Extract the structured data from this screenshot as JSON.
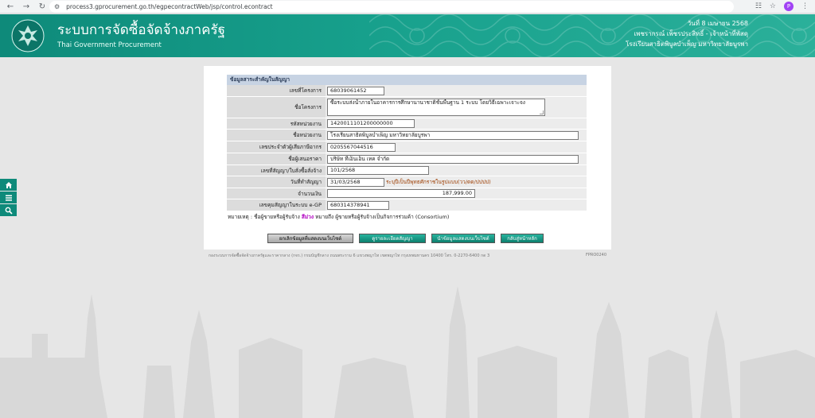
{
  "browser": {
    "url": "process3.gprocurement.go.th/egpecontractWeb/jsp/control.econtract",
    "profile_initial": "P"
  },
  "header": {
    "title_th": "ระบบการจัดซื้อจัดจ้างภาครัฐ",
    "title_en": "Thai Government Procurement",
    "date": "วันที่ 8 เมษายน 2568",
    "user": "เพชรากรณ์ เพ็ชรประสิทธิ์ - เจ้าหน้าที่พัสดุ",
    "org": "โรงเรียนสาธิตพิบูลบำเพ็ญ มหาวิทยาลัยบูรพา"
  },
  "form": {
    "section_title": "ข้อมูลสาระสำคัญในสัญญา",
    "rows": [
      {
        "label": "เลขที่โครงการ",
        "value": "68039061452"
      },
      {
        "label": "ชื่อโครงการ",
        "value": "ซื้อระบบส่งน้ำภายในอาคารการศึกษานานาชาติชั้นพื้นฐาน 1 ระบบ โดยวิธีเฉพาะเจาะจง"
      },
      {
        "label": "รหัสหน่วยงาน",
        "value": "1420011101200000000"
      },
      {
        "label": "ชื่อหน่วยงาน",
        "value": "โรงเรียนสาธิตพิบูลบำเพ็ญ  มหาวิทยาลัยบูรพา"
      },
      {
        "label": "เลขประจำตัวผู้เสียภาษีอากร",
        "value": "0205567044516"
      },
      {
        "label": "ชื่อผู้เสนอราคา",
        "value": "บริษัท ทีเอ็นเอ็น เทค จำกัด"
      },
      {
        "label": "เลขที่สัญญา/ใบสั่งซื้อสั่งจ้าง",
        "value": "101/2568"
      },
      {
        "label": "วันที่ทำสัญญา",
        "value": "31/03/2568",
        "note": "ระบุปีเป็นปีพุทธศักราชในรูปแบบ(วว/ดด/ปปปป)"
      },
      {
        "label": "จำนวนเงิน",
        "value": "187,999.00"
      },
      {
        "label": "เลขคุมสัญญาในระบบ e-GP",
        "value": "680314378941"
      }
    ]
  },
  "remark": {
    "prefix": "หมายเหตุ : ชื่อผู้ขายหรือผู้รับจ้าง",
    "highlight": "สีม่วง",
    "suffix": "หมายถึง ผู้ขายหรือผู้รับจ้างเป็นกิจการร่วมค้า (Consortium)"
  },
  "buttons": {
    "cancel_publish": "ยกเลิกข้อมูลที่แสดงบนเว็บไซต์",
    "view_contract": "ดูรายละเอียดสัญญา",
    "publish": "นำข้อมูลแสดงบนเว็บไซต์",
    "back": "กลับสู่หน้าหลัก"
  },
  "footer": {
    "address": "กองระบบการจัดซื้อจัดจ้างภาครัฐและราคากลาง (กจร.) กรมบัญชีกลาง ถนนพระราม 6 แขวงพญาไท เขตพญาไท กรุงเทพมหานคร 10400 โทร. 0-2270-6400 กด 3",
    "code": "FPRO0240"
  },
  "colors": {
    "header_teal": "#0e8a7a",
    "section_head": "#c7d3e3",
    "consortium_purple": "#b000c0"
  }
}
